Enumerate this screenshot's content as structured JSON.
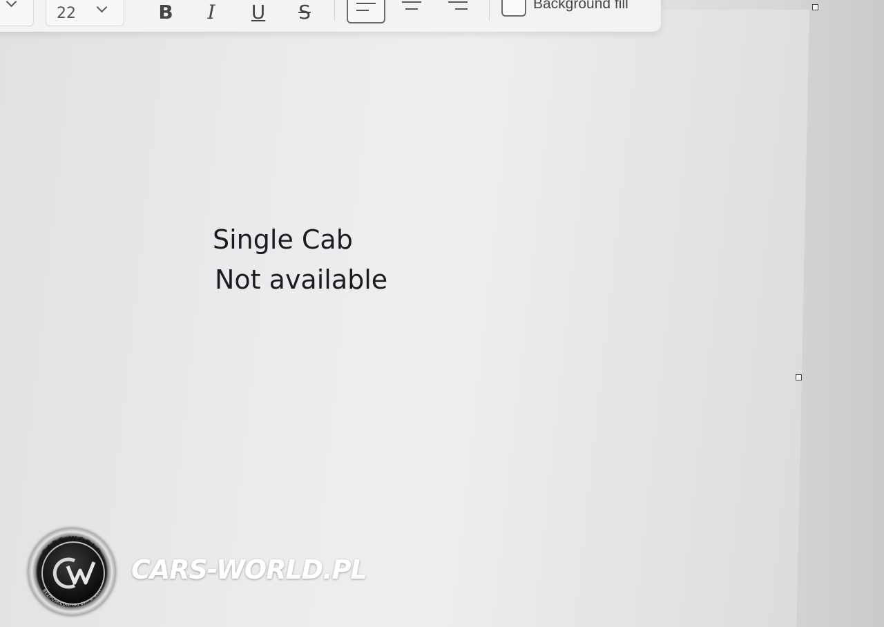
{
  "toolbar": {
    "font_size_value": "22",
    "bold_glyph": "B",
    "italic_glyph": "I",
    "underline_glyph": "U",
    "strikethrough_glyph": "S",
    "background_fill_label": "Background fill",
    "active_alignment": "left"
  },
  "document": {
    "line1": "Single Cab",
    "line2": "Not available"
  },
  "watermark": {
    "brand_text": "CARS-WORLD.PL",
    "logo_ring_top": "CARS-WORLD",
    "logo_ring_bottom": "BEZPOŚREDNI IMPORT Z USA",
    "logo_mark": "CW"
  },
  "icons": {
    "chevron": "chevron-down-icon",
    "checkbox": "checkbox-icon"
  }
}
